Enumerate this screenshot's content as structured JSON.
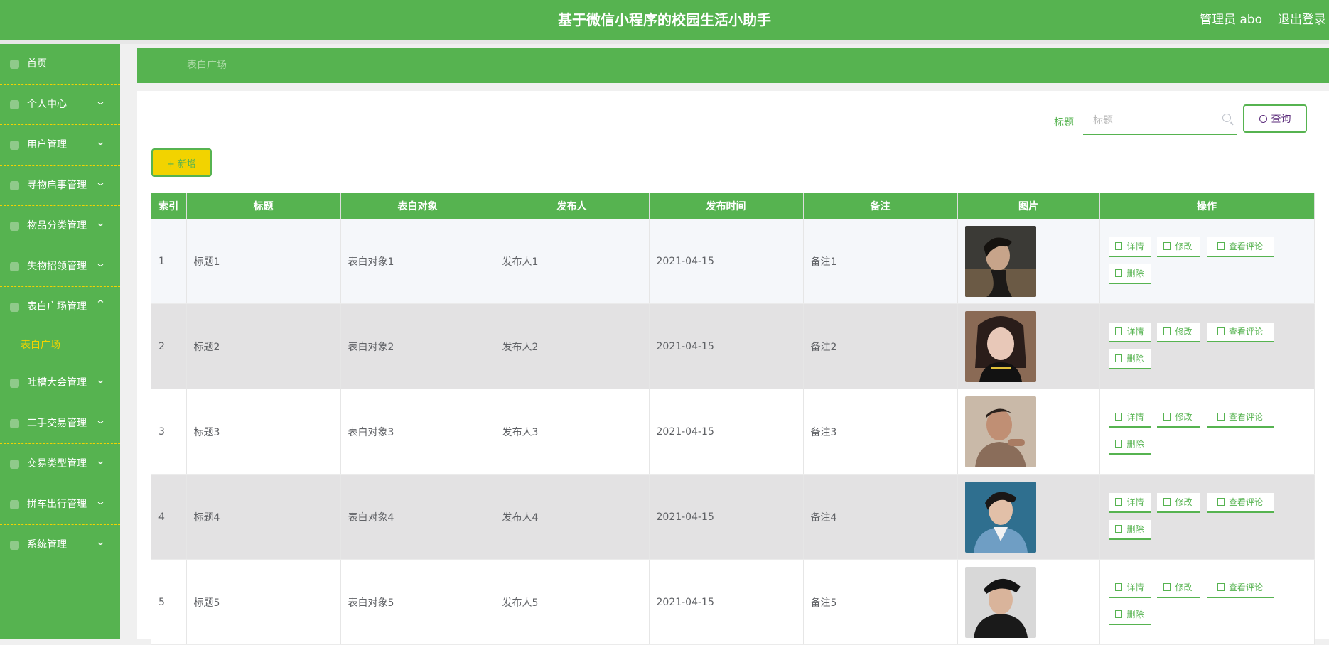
{
  "header": {
    "title": "基于微信小程序的校园生活小助手",
    "user": "管理员 abo",
    "logout": "退出登录"
  },
  "sidebar": {
    "items": [
      {
        "label": "首页",
        "icon": "home-icon",
        "arrow": ""
      },
      {
        "label": "个人中心",
        "icon": "user-icon",
        "arrow": "⌄"
      },
      {
        "label": "用户管理",
        "icon": "users-icon",
        "arrow": "⌄"
      },
      {
        "label": "寻物启事管理",
        "icon": "search-notice-icon",
        "arrow": "⌄"
      },
      {
        "label": "物品分类管理",
        "icon": "category-icon",
        "arrow": "⌄"
      },
      {
        "label": "失物招领管理",
        "icon": "lost-found-icon",
        "arrow": "⌄"
      },
      {
        "label": "表白广场管理",
        "icon": "square-icon",
        "arrow": "⌃"
      },
      {
        "label": "吐槽大会管理",
        "icon": "chart-icon",
        "arrow": "⌄"
      },
      {
        "label": "二手交易管理",
        "icon": "trade-icon",
        "arrow": "⌄"
      },
      {
        "label": "交易类型管理",
        "icon": "type-icon",
        "arrow": "⌄"
      },
      {
        "label": "拼车出行管理",
        "icon": "car-icon",
        "arrow": "⌄"
      },
      {
        "label": "系统管理",
        "icon": "system-icon",
        "arrow": "⌄"
      }
    ],
    "active_sub": "表白广场"
  },
  "breadcrumb": "表白广场",
  "search": {
    "label": "标题",
    "placeholder": "标题",
    "button": "查询"
  },
  "add_button": "+ 新增",
  "table": {
    "headers": [
      "索引",
      "标题",
      "表白对象",
      "发布人",
      "发布时间",
      "备注",
      "图片",
      "操作"
    ],
    "rows": [
      {
        "index": "1",
        "title": "标题1",
        "target": "表白对象1",
        "publisher": "发布人1",
        "time": "2021-04-15",
        "note": "备注1"
      },
      {
        "index": "2",
        "title": "标题2",
        "target": "表白对象2",
        "publisher": "发布人2",
        "time": "2021-04-15",
        "note": "备注2"
      },
      {
        "index": "3",
        "title": "标题3",
        "target": "表白对象3",
        "publisher": "发布人3",
        "time": "2021-04-15",
        "note": "备注3"
      },
      {
        "index": "4",
        "title": "标题4",
        "target": "表白对象4",
        "publisher": "发布人4",
        "time": "2021-04-15",
        "note": "备注4"
      },
      {
        "index": "5",
        "title": "标题5",
        "target": "表白对象5",
        "publisher": "发布人5",
        "time": "2021-04-15",
        "note": "备注5"
      }
    ],
    "actions": {
      "detail": "详情",
      "edit": "修改",
      "comments": "查看评论",
      "delete": "删除"
    }
  },
  "colors": {
    "primary": "#56b350",
    "accent": "#f2d300"
  }
}
